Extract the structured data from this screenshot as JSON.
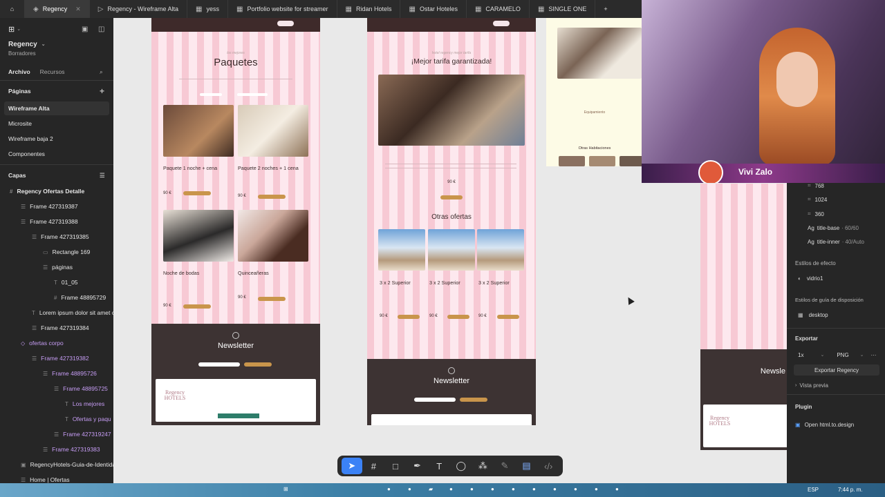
{
  "tabs": [
    {
      "label": "Regency",
      "icon": "figma-icon",
      "active": true
    },
    {
      "label": "Regency - Wireframe Alta",
      "icon": "play-icon"
    },
    {
      "label": "yess",
      "icon": "grid-icon"
    },
    {
      "label": "Portfolio website for streamer",
      "icon": "grid-icon"
    },
    {
      "label": "Ridan Hotels",
      "icon": "grid-icon"
    },
    {
      "label": "Ostar Hoteles",
      "icon": "grid-icon"
    },
    {
      "label": "CARAMELO",
      "icon": "grid-icon"
    },
    {
      "label": "SINGLE ONE",
      "icon": "grid-icon"
    }
  ],
  "sidebar": {
    "project": "Regency",
    "subtitle": "Borradores",
    "tab_file": "Archivo",
    "tab_assets": "Recursos",
    "pages_title": "Páginas",
    "pages": [
      "Wireframe Alta",
      "Microsite",
      "Wireframe baja 2",
      "Componentes"
    ],
    "layers_title": "Capas",
    "layers": [
      {
        "label": "Regency Ofertas Detalle",
        "purple": false
      },
      {
        "label": "Frame 427319387",
        "purple": false
      },
      {
        "label": "Frame 427319388",
        "purple": false
      },
      {
        "label": "Frame 427319385",
        "purple": false
      },
      {
        "label": "Rectangle 169",
        "purple": false
      },
      {
        "label": "páginas",
        "purple": false
      },
      {
        "label": "01_05",
        "purple": false
      },
      {
        "label": "Frame 48895729",
        "purple": false
      },
      {
        "label": "Lorem ipsum dolor sit amet c",
        "purple": false
      },
      {
        "label": "Frame 427319384",
        "purple": false
      },
      {
        "label": "ofertas corpo",
        "purple": true
      },
      {
        "label": "Frame 427319382",
        "purple": true
      },
      {
        "label": "Frame 48895726",
        "purple": true
      },
      {
        "label": "Frame 48895725",
        "purple": true
      },
      {
        "label": "Los mejores",
        "purple": true
      },
      {
        "label": "Ofertas y paqu",
        "purple": true
      },
      {
        "label": "Frame 427319247",
        "purple": true
      },
      {
        "label": "Frame 427319383",
        "purple": true
      },
      {
        "label": "RegencyHotels-Guia-de-Identida",
        "purple": false
      },
      {
        "label": "Home | Ofertas",
        "purple": false
      }
    ]
  },
  "board1": {
    "kicker": "los mejores",
    "title": "Paquetes",
    "cards": [
      {
        "title": "Paquete 1 noche + cena",
        "price": "90 €"
      },
      {
        "title": "Paquete 2 noches + 1 cena",
        "price": "90 €"
      },
      {
        "title": "Noche de bodas",
        "price": "90 €"
      },
      {
        "title": "Quinceañeras",
        "price": "90 €"
      }
    ],
    "newsletter": "Newsletter",
    "hotels_logo": "Regency HOTELS"
  },
  "board2": {
    "kicker": "hotel regency mejor tarifa",
    "title": "¡Mejor tarifa garantizada!",
    "price": "90 €",
    "others_title": "Otras ofertas",
    "offers": [
      {
        "title": "3 x 2 Superior",
        "price": "90 €"
      },
      {
        "title": "3 x 2 Superior",
        "price": "90 €"
      },
      {
        "title": "3 x 2 Superior",
        "price": "90 €"
      }
    ],
    "newsletter": "Newsletter"
  },
  "board3": {
    "section": "Equipamiento",
    "others": "Otras Habitaciones"
  },
  "board4": {
    "newsletter": "Newsle",
    "hotels_logo": "Regency HOTELS"
  },
  "streamer": {
    "name": "Vivi Zalo"
  },
  "rightpanel": {
    "breakpoints": [
      "768",
      "1024",
      "360"
    ],
    "text_styles": [
      {
        "label": "title-base",
        "meta": "60/60"
      },
      {
        "label": "title-inner",
        "meta": "40/Auto"
      }
    ],
    "effects_title": "Estilos de efecto",
    "effect": "vidrio1",
    "layout_title": "Estilos de guía de disposición",
    "layout": "desktop",
    "export_title": "Exportar",
    "export_scale": "1x",
    "export_format": "PNG",
    "export_button": "Exportar Regency",
    "preview": "Vista previa",
    "plugin_title": "Plugin",
    "plugin": "Open html.to.design"
  },
  "taskbar": {
    "lang": "ESP",
    "time": "7:44 p. m."
  },
  "colors": {
    "accent": "#3b82f6",
    "gold": "#c9954b",
    "pink": "#f7c9d4",
    "dark": "#3d3333"
  }
}
